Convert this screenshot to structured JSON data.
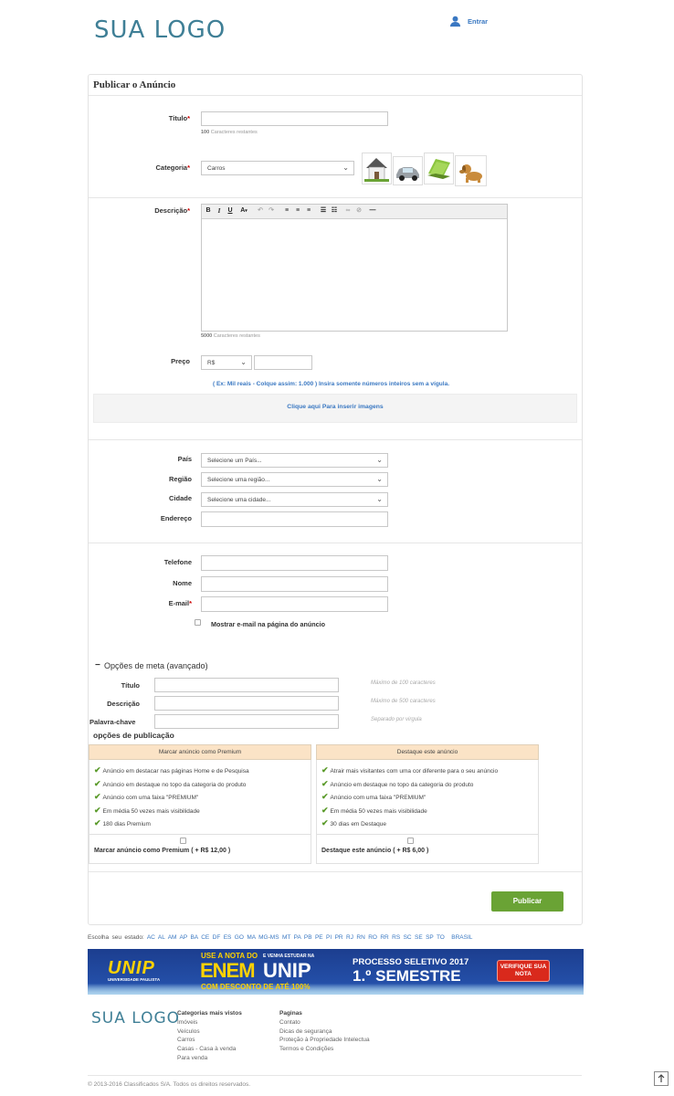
{
  "header": {
    "logo": "SUA LOGO",
    "login_label": "Entrar"
  },
  "form": {
    "title": "Publicar o Anúncio",
    "titulo_label": "Titulo",
    "titulo_hint_count": "100",
    "titulo_hint_text": "Caracteres restantes",
    "categoria_label": "Categoria",
    "categoria_value": "Carros",
    "descricao_label": "Descrição",
    "descricao_hint_count": "5000",
    "descricao_hint_text": "Caracteres restantes",
    "preco_label": "Preço",
    "currency": "R$",
    "price_note": "( Ex: Mil reais - Colque assim: 1.000 ) Insira somente números inteiros sem a vígula.",
    "insert_images": "Clique aqui Para inserir imagens",
    "pais_label": "País",
    "pais_placeholder": "Selecione um País...",
    "regiao_label": "Região",
    "regiao_placeholder": "Selecione uma região...",
    "cidade_label": "Cidade",
    "cidade_placeholder": "Selecione uma cidade...",
    "endereco_label": "Endereço",
    "telefone_label": "Telefone",
    "nome_label": "Nome",
    "email_label": "E-mail",
    "show_email": "Mostrar e-mail na página do anúncio",
    "required_mark": "*"
  },
  "meta": {
    "title": "Opções de meta (avançado)",
    "toggle": "−",
    "titulo_label": "Título",
    "titulo_hint": "Máximo de 100 caracteres",
    "descricao_label": "Descrição",
    "descricao_hint": "Máximo de 500 caracteres",
    "palavra_label": "Palavra-chave",
    "palavra_hint": "Separado por virgula"
  },
  "publication": {
    "title": "opções de publicação",
    "premium": {
      "header": "Marcar anúncio como Premium",
      "features": [
        "Anúncio em destacar nas páginas Home e de Pesquisa",
        "Anúncio em destaque no topo da categoria do produto",
        "Anúncio com uma faixa \"PREMIUM\"",
        "Em média 50 vezes mais visibilidade",
        "180 dias Premium"
      ],
      "option_label": "Marcar anúncio como Premium ( + R$ 12,00 )"
    },
    "destaque": {
      "header": "Destaque este anúncio",
      "features": [
        "Atrair mais visitantes com uma cor diferente para o seu anúncio",
        "Anúncio em destaque no topo da categoria do produto",
        "Anúncio com uma faixa \"PREMIUM\"",
        "Em média 50 vezes mais visibilidade",
        "30 dias em Destaque"
      ],
      "option_label": "Destaque este anúncio ( + R$ 6,00 )"
    },
    "submit": "Publicar"
  },
  "states": {
    "label": "Escolha seu estado:",
    "items": [
      "AC",
      "AL",
      "AM",
      "AP",
      "BA",
      "CE",
      "DF",
      "ES",
      "GO",
      "MA",
      "MG",
      "MS",
      "MT",
      "PA",
      "PB",
      "PE",
      "PI",
      "PR",
      "RJ",
      "RN",
      "RO",
      "RR",
      "RS",
      "SC",
      "SE",
      "SP",
      "TO",
      "BRASIL"
    ]
  },
  "banner": {
    "brand": "UNIP",
    "brand_sub": "UNIVERSIDADE PAULISTA",
    "use_nota": "USE A NOTA DO",
    "enem": "ENEM",
    "venha": "E VENHA ESTUDAR NA",
    "unip": "UNIP",
    "desconto": "COM DESCONTO DE ATÉ 100%",
    "processo": "PROCESSO SELETIVO 2017",
    "semestre": "1.º SEMESTRE",
    "cta": "VERIFIQUE SUA NOTA"
  },
  "footer": {
    "logo": "SUA LOGO",
    "col1_title": "Categorias mais vistos",
    "col1": [
      "Imóveis",
      "Veículos",
      "Carros",
      "Casas - Casa à venda",
      "Para venda"
    ],
    "col2_title": "Paginas",
    "col2": [
      "Contato",
      "Dicas de segurança",
      "Proteção à Propriedade Intelectua",
      "Termos e Condições"
    ],
    "copyright": "© 2013-2016 Classificados S/A. Todos os direitos reservados."
  },
  "colors": {
    "accent": "#3a78c2",
    "logo": "#3f7f96",
    "publish": "#6aa335",
    "panel_header": "#fbe3c6"
  }
}
